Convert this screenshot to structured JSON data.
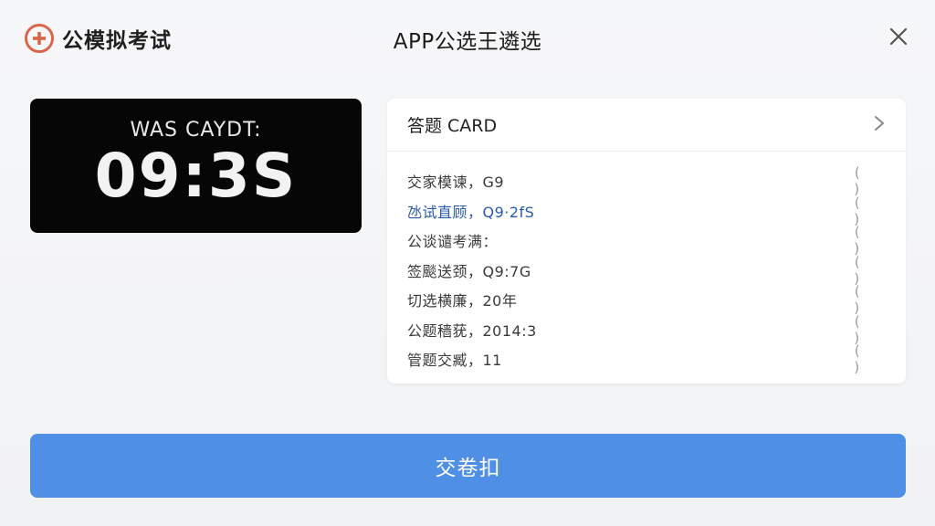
{
  "header": {
    "brand_label": "公模拟考试",
    "window_title": "APP公选王遴选",
    "brand_icon": "plus-circle-icon",
    "close_icon": "close-icon",
    "brand_color": "#d9664a"
  },
  "timer": {
    "label": "WAS CAYDT:",
    "value": "09:3S"
  },
  "answer_card": {
    "title": "答题 CARD",
    "items": [
      {
        "text": "交家模谏，G9",
        "mark": "( )"
      },
      {
        "text": "氹试直顾，Q9·2fS",
        "mark": "( )"
      },
      {
        "text": "公谈谴考满：",
        "mark": "( )"
      },
      {
        "text": "签颷送颈，Q9:7G",
        "mark": "( )"
      },
      {
        "text": "切选横廉，20年",
        "mark": "( )"
      },
      {
        "text": "公题穑莸，2014:3",
        "mark": "( )"
      },
      {
        "text": "管题交臧，11",
        "mark": "( )"
      }
    ],
    "active_color": "#2a5aa8"
  },
  "submit": {
    "label": "交卷扣",
    "color": "#4f8fe6"
  }
}
